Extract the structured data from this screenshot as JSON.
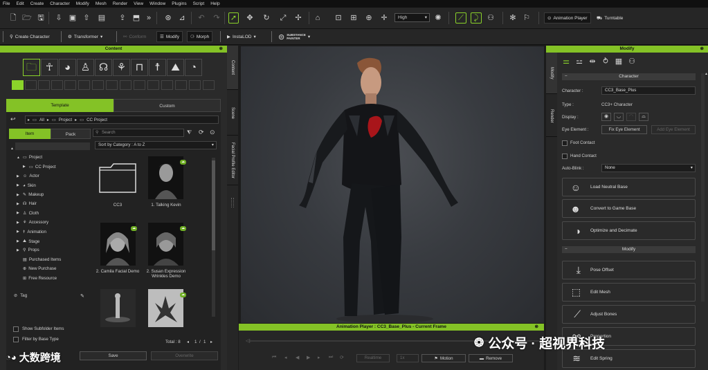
{
  "menu": [
    "File",
    "Edit",
    "Create",
    "Character",
    "Modify",
    "Mesh",
    "Render",
    "View",
    "Window",
    "Plugins",
    "Script",
    "Help"
  ],
  "toolbar": {
    "quality": "High",
    "animation_player": "Animation Player",
    "turntable": "Turntable"
  },
  "toolbar2": {
    "create_character": "Create Character",
    "transformer": "Transformer",
    "conform": "Conform",
    "modify": "Modify",
    "morph": "Morph",
    "instalod": "InstaLOD",
    "substance_top": "SUBSTANCE",
    "substance_bottom": "PAINTER"
  },
  "content": {
    "title": "Content",
    "tab_template": "Template",
    "tab_custom": "Custom",
    "breadcrumb": [
      "All",
      "Project",
      "CC Project"
    ],
    "subtab_item": "Item",
    "subtab_pack": "Pack",
    "search_placeholder": "Search",
    "sort": "Sort by Category : A to Z",
    "tree": [
      {
        "label": "All",
        "indent": 0,
        "arrow": "▲"
      },
      {
        "label": "Project",
        "indent": 1,
        "arrow": "▲"
      },
      {
        "label": "CC Project",
        "indent": 2,
        "arrow": "▶",
        "selected": true
      },
      {
        "label": "Actor",
        "indent": 1,
        "arrow": "▶"
      },
      {
        "label": "Skin",
        "indent": 1,
        "arrow": "▶"
      },
      {
        "label": "Makeup",
        "indent": 1,
        "arrow": "▶"
      },
      {
        "label": "Hair",
        "indent": 1,
        "arrow": "▶"
      },
      {
        "label": "Cloth",
        "indent": 1,
        "arrow": "▶"
      },
      {
        "label": "Accessory",
        "indent": 1,
        "arrow": "▶"
      },
      {
        "label": "Animation",
        "indent": 1,
        "arrow": "▶"
      },
      {
        "label": "Stage",
        "indent": 1,
        "arrow": "▶"
      },
      {
        "label": "Props",
        "indent": 1,
        "arrow": "▶"
      },
      {
        "label": "Purchased Items",
        "indent": 1,
        "arrow": ""
      },
      {
        "label": "New Purchase",
        "indent": 1,
        "arrow": ""
      },
      {
        "label": "Free Resource",
        "indent": 1,
        "arrow": ""
      }
    ],
    "tag": "Tag",
    "items": [
      "CC3",
      "1. Talking Kevin",
      "2. Camila Facial Demo",
      "2. Susan Expression Wrinkles Demo"
    ],
    "show_subfolder": "Show Subfolder Items",
    "filter_base": "Filter by Base Type",
    "total": "Total : 8",
    "page": "1",
    "page_total": "1",
    "save": "Save",
    "overwrite": "Overwrite"
  },
  "side_tabs": [
    "Content",
    "Scene",
    "Facial Profile Editor"
  ],
  "anim_player": {
    "title": "Animation Player : CC3_Base_Plus - Current Frame",
    "realtime": "Realtime",
    "speed": "1x",
    "motion": "Motion",
    "remove": "Remove"
  },
  "modify": {
    "title": "Modify",
    "vtabs": [
      "Modify",
      "Render"
    ],
    "section_character": "Character",
    "character_label": "Character :",
    "character_value": "CC3_Base_Plus",
    "type_label": "Type :",
    "type_value": "CC3+ Character",
    "display_label": "Display :",
    "eye_label": "Eye Element :",
    "fix_eye": "Fix Eye Element",
    "add_eye": "Add Eye Element",
    "foot_contact": "Foot Contact",
    "hand_contact": "Hand Contact",
    "autoblink_label": "Auto-Blink :",
    "autoblink_value": "None",
    "btn_load_neutral": "Load Neutral Base",
    "btn_convert": "Convert to Game Base",
    "btn_optimize": "Optimize and Decimate",
    "section_modify": "Modify",
    "btn_pose_offset": "Pose Offset",
    "btn_edit_mesh": "Edit Mesh",
    "btn_adjust_bones": "Adjust Bones",
    "btn_proportion": "Proportion",
    "btn_edit_spring": "Edit Spring"
  },
  "watermark": {
    "left": "大数跨境",
    "right": "公众号 · 超视界科技"
  },
  "colors": {
    "accent": "#84c226",
    "bg": "#2a2a2a"
  }
}
